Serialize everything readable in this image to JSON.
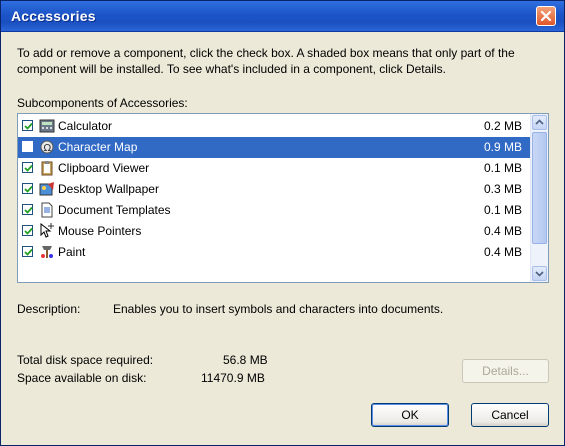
{
  "window": {
    "title": "Accessories"
  },
  "instructions": "To add or remove a component, click the check box. A shaded box means that only part of the component will be installed. To see what's included in a component, click Details.",
  "list": {
    "label": "Subcomponents of Accessories:",
    "items": [
      {
        "name": "Calculator",
        "size": "0.2 MB",
        "checked": true,
        "selected": false,
        "icon": "calculator-icon"
      },
      {
        "name": "Character Map",
        "size": "0.9 MB",
        "checked": false,
        "selected": true,
        "icon": "character-map-icon"
      },
      {
        "name": "Clipboard Viewer",
        "size": "0.1 MB",
        "checked": true,
        "selected": false,
        "icon": "clipboard-icon"
      },
      {
        "name": "Desktop Wallpaper",
        "size": "0.3 MB",
        "checked": true,
        "selected": false,
        "icon": "wallpaper-icon"
      },
      {
        "name": "Document Templates",
        "size": "0.1 MB",
        "checked": true,
        "selected": false,
        "icon": "document-icon"
      },
      {
        "name": "Mouse Pointers",
        "size": "0.4 MB",
        "checked": true,
        "selected": false,
        "icon": "mouse-pointer-icon"
      },
      {
        "name": "Paint",
        "size": "0.4 MB",
        "checked": true,
        "selected": false,
        "icon": "paint-icon"
      }
    ]
  },
  "description": {
    "label": "Description:",
    "text": "Enables you to insert symbols and characters into documents."
  },
  "disk": {
    "total_label": "Total disk space required:",
    "total_value": "56.8 MB",
    "available_label": "Space available on disk:",
    "available_value": "11470.9 MB"
  },
  "buttons": {
    "details": "Details...",
    "ok": "OK",
    "cancel": "Cancel"
  },
  "colors": {
    "titlebar": "#1c55c8",
    "selection": "#316ac5",
    "dialog_bg": "#ece9d8"
  }
}
